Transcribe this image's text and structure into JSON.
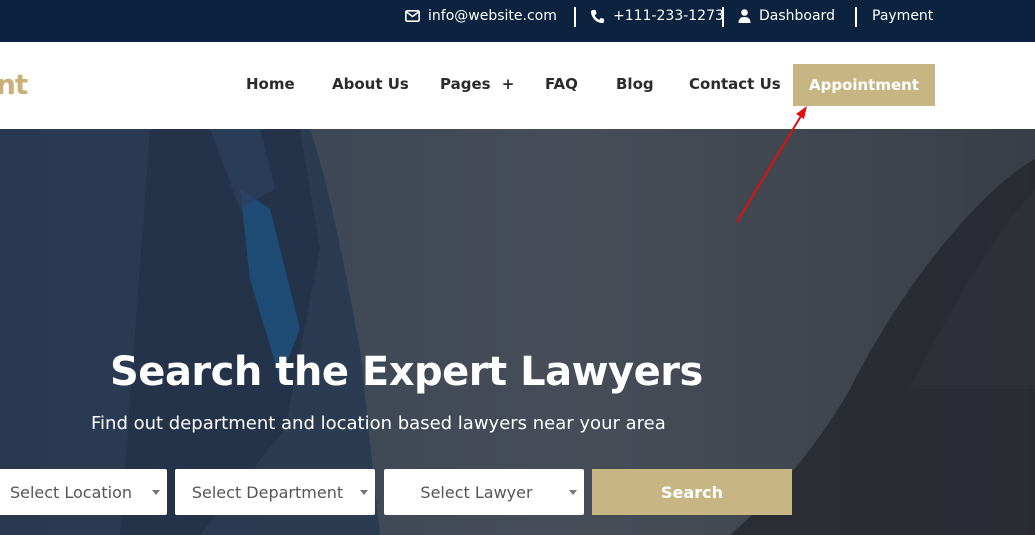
{
  "topbar": {
    "email": "info@website.com",
    "phone": "+111-233-1273",
    "dashboard": "Dashboard",
    "payment": "Payment"
  },
  "header": {
    "logo_fragment": "nt",
    "nav": {
      "home": "Home",
      "about": "About Us",
      "pages": "Pages",
      "pages_toggle": "+",
      "faq": "FAQ",
      "blog": "Blog",
      "contact": "Contact Us"
    },
    "appointment": "Appointment"
  },
  "hero": {
    "title": "Search the Expert Lawyers",
    "subtitle": "Find out department and location based lawyers near your area",
    "location_placeholder": "Select Location",
    "department_placeholder": "Select Department",
    "lawyer_placeholder": "Select Lawyer",
    "search_label": "Search"
  },
  "colors": {
    "topbar_bg": "#0c2340",
    "accent": "#c7b684",
    "annotation_arrow": "#e01010"
  },
  "icons": {
    "email": "envelope-icon",
    "phone": "phone-icon",
    "dashboard": "user-icon"
  }
}
